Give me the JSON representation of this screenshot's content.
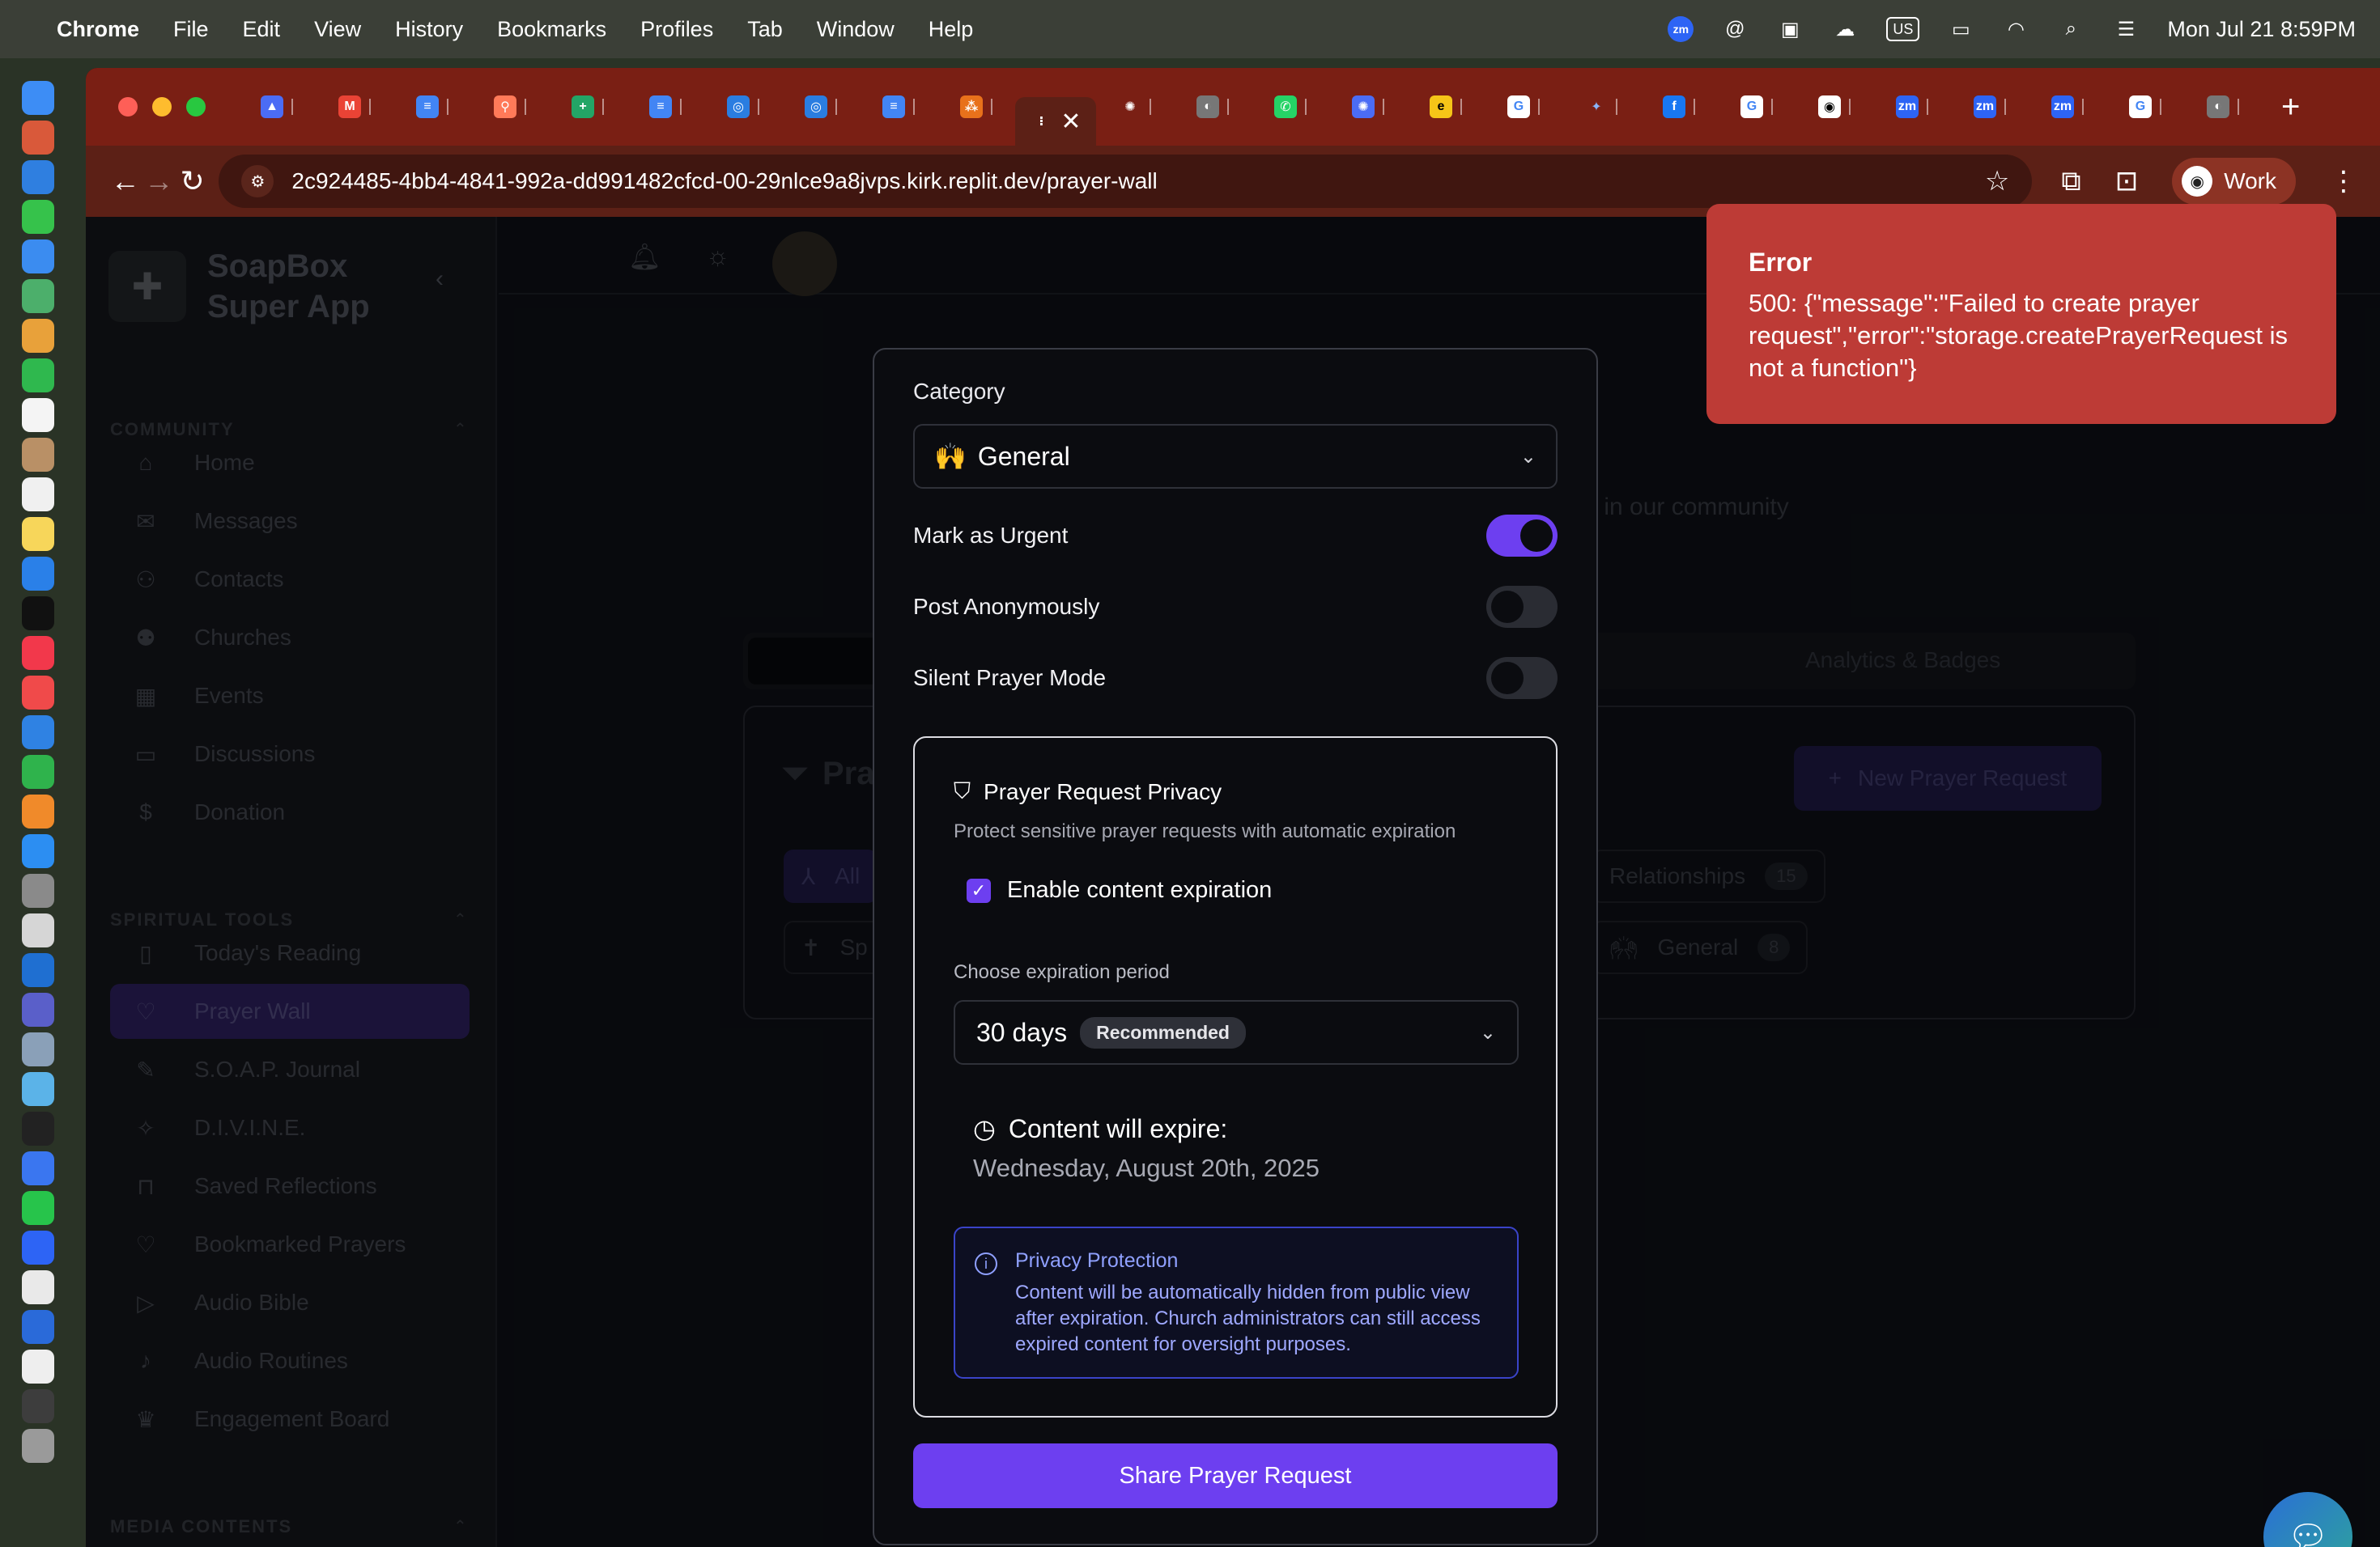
{
  "menubar": {
    "app": "Chrome",
    "items": [
      "File",
      "Edit",
      "View",
      "History",
      "Bookmarks",
      "Profiles",
      "Tab",
      "Window",
      "Help"
    ],
    "input_source": "US",
    "datetime": "Mon Jul 21  8:59PM"
  },
  "browser": {
    "url": "2c924485-4bb4-4841-992a-dd991482cfcd-00-29nlce9a8jvps.kirk.replit.dev/prayer-wall",
    "profile_label": "Work",
    "tab_favicons": [
      "zm",
      "M",
      "D",
      "H",
      "S",
      "D",
      "S",
      "S",
      "D",
      "L",
      "active",
      "O",
      "G",
      "W",
      "C",
      "E",
      "G",
      "*",
      "f",
      "G",
      "GH",
      "zm",
      "zm",
      "zm",
      "G",
      "G"
    ]
  },
  "sidebar": {
    "brand": "SoapBox Super App",
    "brand_line1": "SoapBox",
    "brand_line2": "Super App",
    "community_title": "COMMUNITY",
    "community": [
      "Home",
      "Messages",
      "Contacts",
      "Churches",
      "Events",
      "Discussions",
      "Donation"
    ],
    "tools_title": "SPIRITUAL TOOLS",
    "tools": [
      "Today's Reading",
      "Prayer Wall",
      "S.O.A.P. Journal",
      "D.I.V.I.N.E.",
      "Saved Reflections",
      "Bookmarked Prayers",
      "Audio Bible",
      "Audio Routines",
      "Engagement Board"
    ],
    "media_title": "MEDIA CONTENTS"
  },
  "background": {
    "subtitle_fragment": "s in our community",
    "tab_analytics": "Analytics & Badges",
    "panel_title_fragment": "Pra",
    "new_request": "New Prayer Request",
    "pill_all": "All",
    "pill_sp": "Sp",
    "pill_relationships": "Relationships",
    "pill_relationships_count": "15",
    "pill_general": "General",
    "pill_general_count": "8"
  },
  "modal": {
    "category_label": "Category",
    "category_value": "General",
    "category_icon": "🙌",
    "urgent_label": "Mark as Urgent",
    "urgent_on": true,
    "anon_label": "Post Anonymously",
    "anon_on": false,
    "silent_label": "Silent Prayer Mode",
    "silent_on": false,
    "privacy": {
      "title": "Prayer Request Privacy",
      "description": "Protect sensitive prayer requests with automatic expiration",
      "enable_label": "Enable content expiration",
      "enable_checked": true,
      "period_label": "Choose expiration period",
      "period_value": "30 days",
      "period_badge": "Recommended",
      "expire_title": "Content will expire:",
      "expire_date": "Wednesday, August 20th, 2025",
      "protection_title": "Privacy Protection",
      "protection_text": "Content will be automatically hidden from public view after expiration. Church administrators can still access expired content for oversight purposes."
    },
    "submit_label": "Share Prayer Request"
  },
  "toast": {
    "title": "Error",
    "message": "500: {\"message\":\"Failed to create prayer request\",\"error\":\"storage.createPrayerRequest is not a function\"}"
  },
  "colors": {
    "accent": "#6d3ff0",
    "error": "#bd3b36",
    "tabbar": "#7a1f14",
    "toolbar": "#5c2016"
  }
}
